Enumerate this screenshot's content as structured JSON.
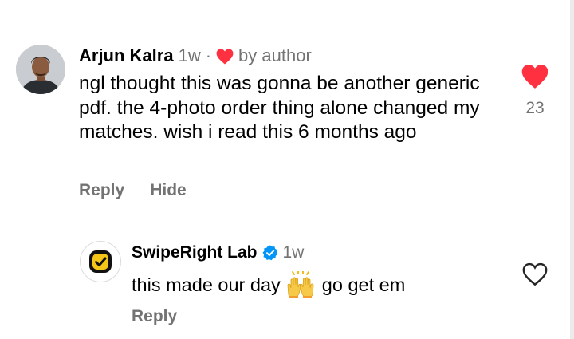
{
  "comment": {
    "username": "Arjun Kalra",
    "time": "1w",
    "separator": "·",
    "author_badge": "by author",
    "text": "ngl thought this was gonna be another generic pdf. the 4-photo order thing alone changed my matches. wish i read this 6 months ago",
    "actions": {
      "reply_label": "Reply",
      "hide_label": "Hide"
    },
    "likes": {
      "count": "23",
      "liked": true,
      "icon": "heart-filled-icon"
    }
  },
  "reply": {
    "username": "SwipeRight Lab",
    "verified": true,
    "time": "1w",
    "text_before": "this made our day",
    "emoji": "raising-hands",
    "text_after": "go get em",
    "actions": {
      "reply_label": "Reply"
    },
    "likes": {
      "liked": false,
      "icon": "heart-outline-icon"
    }
  },
  "colors": {
    "text_primary": "#000000",
    "text_secondary": "#737373",
    "like_red": "#ff3040",
    "verified_blue": "#0095f6",
    "brand_yellow": "#f5c518"
  }
}
